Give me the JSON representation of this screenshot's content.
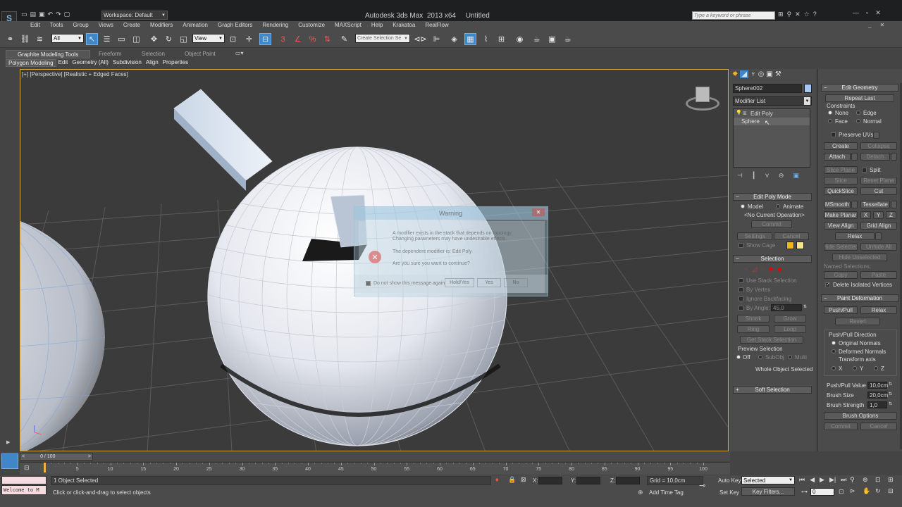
{
  "titlebar": {
    "workspace": "Workspace: Default",
    "title": "Autodesk 3ds Max  2013 x64     Untitled",
    "search_placeholder": "Type a keyword or phrase"
  },
  "menu": [
    "Edit",
    "Tools",
    "Group",
    "Views",
    "Create",
    "Modifiers",
    "Animation",
    "Graph Editors",
    "Rendering",
    "Customize",
    "MAXScript",
    "Help",
    "Krakatoa",
    "RealFlow"
  ],
  "toolbar": {
    "filter": "All",
    "refcoord": "View",
    "selection_set": "Create Selection Se"
  },
  "ribbon": {
    "tabs": [
      "Graphite Modeling Tools",
      "Freeform",
      "Selection",
      "Object Paint"
    ],
    "subtabs": [
      "Polygon Modeling",
      "Edit",
      "Geometry (All)",
      "Subdivision",
      "Align",
      "Properties"
    ]
  },
  "viewport": {
    "label": "[+] [Perspective] [Realistic + Edged Faces]"
  },
  "dialog": {
    "title": "Warning",
    "line1": "A modifier exists in the stack that depends on topology.",
    "line2": "Changing parameters may have undesirable effects.",
    "line3": "The dependent modifier is:  Edit Poly",
    "line4": "Are you sure you want to continue?",
    "checkbox": "Do not show this message again",
    "hold": "Hold/Yes",
    "yes": "Yes",
    "no": "No"
  },
  "command_panel": {
    "object_name": "Sphere002",
    "modifier_list": "Modifier List",
    "stack": [
      "Edit Poly",
      "Sphere"
    ],
    "edit_poly_mode": {
      "title": "Edit Poly Mode",
      "model": "Model",
      "animate": "Animate",
      "operation": "<No Current Operation>",
      "commit": "Commit",
      "settings": "Settings",
      "cancel": "Cancel",
      "show_cage": "Show Cage"
    },
    "selection": {
      "title": "Selection",
      "use_stack": "Use Stack Selection",
      "by_vertex": "By Vertex",
      "ignore_backfacing": "Ignore Backfacing",
      "by_angle": "By Angle:",
      "angle_value": "45,0",
      "shrink": "Shrink",
      "grow": "Grow",
      "ring": "Ring",
      "loop": "Loop",
      "get_stack": "Get Stack Selection",
      "preview": "Preview Selection",
      "off": "Off",
      "subobj": "SubObj",
      "multi": "Multi",
      "whole": "Whole Object Selected"
    },
    "soft_selection": "Soft Selection"
  },
  "edit_geometry": {
    "title": "Edit Geometry",
    "repeat_last": "Repeat Last",
    "constraints": "Constraints",
    "none": "None",
    "edge": "Edge",
    "face": "Face",
    "normal": "Normal",
    "preserve_uvs": "Preserve UVs",
    "create": "Create",
    "collapse": "Collapse",
    "attach": "Attach",
    "detach": "Detach",
    "slice_plane": "Slice Plane",
    "split": "Split",
    "slice": "Slice",
    "reset_plane": "Reset Plane",
    "quickslice": "QuickSlice",
    "cut": "Cut",
    "msmooth": "MSmooth",
    "tessellate": "Tessellate",
    "make_planar": "Make Planar",
    "x": "X",
    "y": "Y",
    "z": "Z",
    "view_align": "View Align",
    "grid_align": "Grid Align",
    "relax": "Relax",
    "hide_selected": "Hide Selected",
    "unhide_all": "Unhide All",
    "hide_unselected": "Hide Unselected",
    "named_selections": "Named Selections:",
    "copy": "Copy",
    "paste": "Paste",
    "delete_isolated": "Delete Isolated Vertices"
  },
  "paint_deformation": {
    "title": "Paint Deformation",
    "push_pull": "Push/Pull",
    "relax": "Relax",
    "revert": "Revert",
    "direction": "Push/Pull Direction",
    "original": "Original Normals",
    "deformed": "Deformed Normals",
    "transform_axis": "Transform axis",
    "x": "X",
    "y": "Y",
    "z": "Z",
    "value_label": "Push/Pull Value",
    "value": "10,0cm",
    "size_label": "Brush Size",
    "size": "20,0cm",
    "strength_label": "Brush Strength",
    "strength": "1,0",
    "options": "Brush Options",
    "commit": "Commit",
    "cancel": "Cancel"
  },
  "timeline": {
    "frame": "0 / 100",
    "ticks": [
      "5",
      "10",
      "15",
      "20",
      "25",
      "30",
      "35",
      "40",
      "45",
      "50",
      "55",
      "60",
      "65",
      "70",
      "75",
      "80",
      "85",
      "90",
      "95",
      "100"
    ]
  },
  "status": {
    "listener": "Welcome to M",
    "objects_selected": "1 Object Selected",
    "prompt": "Click or click-and-drag to select objects",
    "x": "X:",
    "y": "Y:",
    "z": "Z:",
    "grid": "Grid = 10,0cm",
    "add_time_tag": "Add Time Tag",
    "auto_key": "Auto Key",
    "set_key": "Set Key",
    "key_mode": "Selected",
    "key_filters": "Key Filters...",
    "current_frame": "0"
  }
}
